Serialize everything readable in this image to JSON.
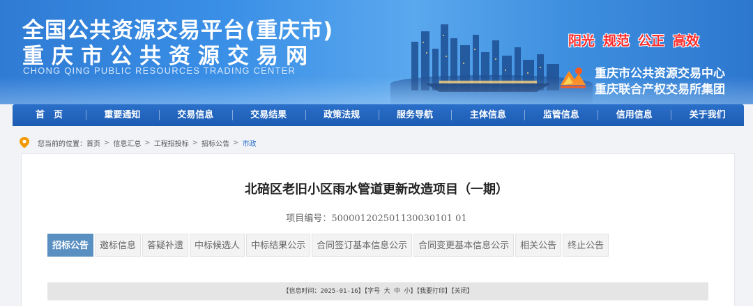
{
  "header": {
    "title_line1": "全国公共资源交易平台(重庆市)",
    "title_line2": "重庆市公共资源交易网",
    "title_en": "CHONG QING PUBLIC RESOURCES TRADING CENTER",
    "slogans": [
      "阳光",
      "规范",
      "公正",
      "高效"
    ],
    "org_line1": "重庆市公共资源交易中心",
    "org_line2": "重庆联合产权交易所集团",
    "logo_icon": "cq-exchange-logo-icon"
  },
  "nav": {
    "items": [
      "首　页",
      "重要通知",
      "交易信息",
      "交易结果",
      "政策法规",
      "服务导航",
      "主体信息",
      "监管信息",
      "信用信息",
      "关于我们"
    ]
  },
  "breadcrumb": {
    "prefix": "您当前的位置：",
    "items": [
      "首页",
      "信息汇总",
      "工程招投标",
      "招标公告",
      "市政"
    ],
    "icon": "location-pin-icon"
  },
  "project": {
    "title": "北碚区老旧小区雨水管道更新改造项目（一期）",
    "number_label": "项目编号：",
    "number": "500001202501130030101 01"
  },
  "tabs": [
    "招标公告",
    "邀标信息",
    "答疑补遗",
    "中标候选人",
    "中标结果公示",
    "合同签订基本信息公示",
    "合同变更基本信息公示",
    "相关公告",
    "终止公告"
  ],
  "info_bar": {
    "time_label": "【信息时间：",
    "time": "2025-01-16",
    "font_label": "】【字号",
    "size_large": "大",
    "size_mid": "中",
    "size_small": "小",
    "print": "】【我要打印】",
    "close": "【关闭】"
  },
  "colors": {
    "banner_blue": "#3a8fe6",
    "nav_blue": "#1d5cb3",
    "active_tab": "#5a8fc1",
    "slogan_red": "#ff2b2b"
  }
}
